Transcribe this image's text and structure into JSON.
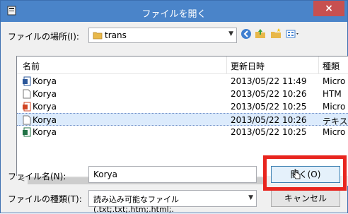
{
  "window": {
    "title": "ファイルを開く",
    "close_symbol": "×"
  },
  "location": {
    "label": "ファイルの場所(I):",
    "value": "trans"
  },
  "columns": {
    "name": "名前",
    "modified": "更新日時",
    "type": "種類"
  },
  "files": [
    {
      "name": "Korya",
      "date": "2013/05/22 11:49",
      "type": "Micro",
      "icon": "word-doc-icon",
      "selected": false
    },
    {
      "name": "Korya",
      "date": "2013/05/22 10:26",
      "type": "HTM",
      "icon": "blank-file-icon",
      "selected": false
    },
    {
      "name": "Korya",
      "date": "2013/05/22 10:25",
      "type": "Micro",
      "icon": "powerpoint-icon",
      "selected": false
    },
    {
      "name": "Korya",
      "date": "2013/05/22 10:26",
      "type": "テキス",
      "icon": "text-file-icon",
      "selected": true
    },
    {
      "name": "Korya",
      "date": "2013/05/22 10:25",
      "type": "Micro",
      "icon": "excel-icon",
      "selected": false
    }
  ],
  "filename": {
    "label": "ファイル名(N):",
    "value": "Korya"
  },
  "filetype": {
    "label": "ファイルの種類(T):",
    "value": "読み込み可能なファイル(.txt;.txt;.htm;.html;."
  },
  "buttons": {
    "open": "開く(O)",
    "cancel": "キャンセル"
  },
  "colors": {
    "titlebar": "#4a84c9",
    "highlight": "#e8251e",
    "selection": "#dcebfc"
  }
}
